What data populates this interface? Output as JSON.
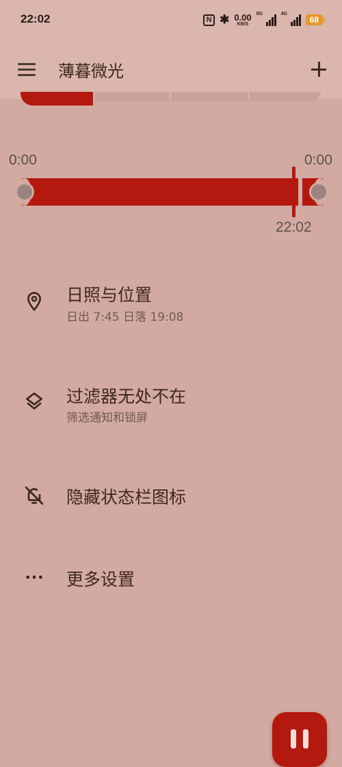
{
  "status_bar": {
    "time": "22:02",
    "nfc": "N",
    "speed_value": "0.00",
    "speed_unit": "KB/S",
    "signal1_tag": "5G",
    "signal2_tag": "4G",
    "battery": "68"
  },
  "app_bar": {
    "title": "薄暮微光"
  },
  "timeline": {
    "start_label": "0:00",
    "end_label": "0:00",
    "now_label": "22:02"
  },
  "settings": [
    {
      "title": "日照与位置",
      "subtitle": "日出 7:45 日落 19:08",
      "icon": "location-pin-icon"
    },
    {
      "title": "过滤器无处不在",
      "subtitle": "筛选通知和锁屏",
      "icon": "layers-icon"
    },
    {
      "title": "隐藏状态栏图标",
      "icon": "bell-off-icon"
    },
    {
      "title": "更多设置",
      "icon": "more-horizontal-icon"
    }
  ],
  "fab": {
    "icon": "pause-icon"
  },
  "colors": {
    "accent": "#b3190e",
    "background": "#d3aaa1",
    "surface": "#dab6ad"
  }
}
